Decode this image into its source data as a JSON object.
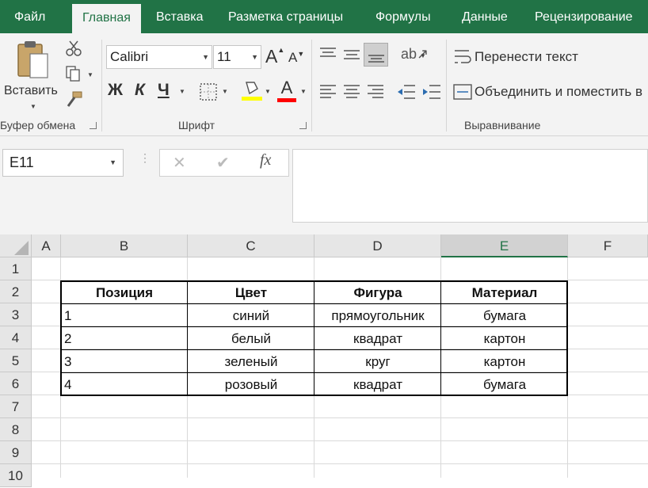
{
  "ribbon_tabs": [
    "Файл",
    "Главная",
    "Вставка",
    "Разметка страницы",
    "Формулы",
    "Данные",
    "Рецензирование"
  ],
  "clipboard": {
    "paste_label": "Вставить",
    "group_label": "Буфер обмена"
  },
  "font": {
    "name": "Calibri",
    "size": "11",
    "bold": "Ж",
    "italic": "К",
    "underline": "Ч",
    "grow": "A",
    "shrink": "A",
    "color_letter": "A",
    "group_label": "Шрифт",
    "fill_color": "#ffff00",
    "font_color": "#ff0000"
  },
  "alignment": {
    "wrap_text": "Перенести текст",
    "merge_center": "Объединить и поместить в",
    "group_label": "Выравнивание"
  },
  "formula_bar": {
    "name_box": "E11",
    "fx": "fx",
    "cancel": "✕",
    "enter": "✔",
    "formula": ""
  },
  "columns": [
    "A",
    "B",
    "C",
    "D",
    "E",
    "F"
  ],
  "rows": [
    "1",
    "2",
    "3",
    "4",
    "5",
    "6",
    "7",
    "8",
    "9",
    "10"
  ],
  "selected_column": "E",
  "table": {
    "headers": [
      "Позиция",
      "Цвет",
      "Фигура",
      "Материал"
    ],
    "rows": [
      [
        "1",
        "синий",
        "прямоугольник",
        "бумага"
      ],
      [
        "2",
        "белый",
        "квадрат",
        "картон"
      ],
      [
        "3",
        "зеленый",
        "круг",
        "картон"
      ],
      [
        "4",
        "розовый",
        "квадрат",
        "бумага"
      ]
    ]
  },
  "colors": {
    "accent": "#217346"
  }
}
